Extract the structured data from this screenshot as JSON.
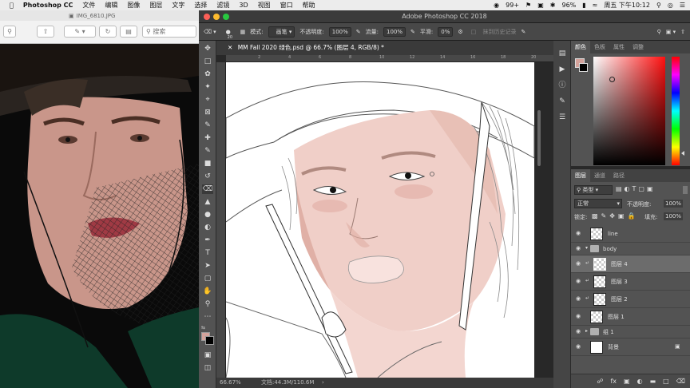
{
  "menubar": {
    "app_name": "Photoshop CC",
    "menus": [
      "文件",
      "编辑",
      "图像",
      "图层",
      "文字",
      "选择",
      "滤镜",
      "3D",
      "视图",
      "窗口",
      "帮助"
    ],
    "notifications": "99+",
    "battery": "96%",
    "datetime": "周五 下午10:12"
  },
  "preview": {
    "title": "IMG_6810.JPG",
    "search_placeholder": "搜索"
  },
  "photoshop": {
    "window_title": "Adobe Photoshop CC 2018",
    "options": {
      "brush_size": "20",
      "mode_label": "模式:",
      "mode_value": "画笔",
      "opacity_label": "不透明度:",
      "opacity_value": "100%",
      "flow_label": "流量:",
      "flow_value": "100%",
      "smooth_label": "平滑:",
      "smooth_value": "0%",
      "history_label": "抹到历史记录"
    },
    "document_tab": "MM Fall 2020 绿色.psd @ 66.7% (图层 4, RGB/8) *",
    "status": {
      "zoom": "66.67%",
      "doc_size": "文档:44.3M/110.6M"
    },
    "ruler_marks": [
      "2",
      "4",
      "6",
      "8",
      "10",
      "12",
      "14",
      "16",
      "18",
      "20"
    ]
  },
  "color_panel": {
    "tabs": [
      "颜色",
      "色板",
      "属性",
      "调整"
    ],
    "foreground": "#d4a39c",
    "background": "#000000"
  },
  "layers_panel": {
    "tabs": [
      "图层",
      "通道",
      "路径"
    ],
    "filter_label": "类型",
    "blend_mode": "正常",
    "opacity_label": "不透明度:",
    "opacity_value": "100%",
    "lock_label": "锁定:",
    "fill_label": "填充:",
    "fill_value": "100%",
    "layers": [
      {
        "name": "line"
      },
      {
        "name": "body"
      },
      {
        "name": "图层 4"
      },
      {
        "name": "图层 3"
      },
      {
        "name": "图层 2"
      },
      {
        "name": "图层 1"
      },
      {
        "name": "组 1"
      },
      {
        "name": "背景"
      }
    ]
  }
}
